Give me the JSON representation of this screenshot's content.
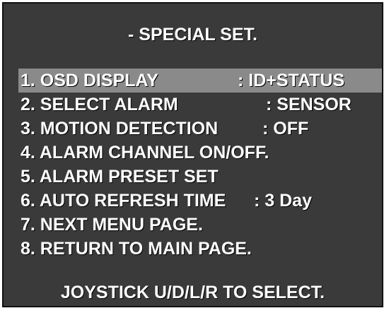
{
  "title": "- SPECIAL SET.",
  "menu": [
    {
      "label": "1. OSD DISPLAY",
      "value": ": ID+STATUS",
      "selected": true
    },
    {
      "label": "2. SELECT ALARM",
      "value": ": SENSOR",
      "selected": false
    },
    {
      "label": "3. MOTION DETECTION",
      "value": ": OFF",
      "selected": false
    },
    {
      "label": "4. ALARM CHANNEL ON/OFF.",
      "value": "",
      "selected": false
    },
    {
      "label": "5. ALARM PRESET SET",
      "value": "",
      "selected": false
    },
    {
      "label": "6. AUTO REFRESH TIME",
      "value": ": 3 Day",
      "selected": false
    },
    {
      "label": "7. NEXT MENU PAGE.",
      "value": "",
      "selected": false
    },
    {
      "label": "8. RETURN TO MAIN PAGE.",
      "value": "",
      "selected": false
    }
  ],
  "footer": "JOYSTICK U/D/L/R TO SELECT.",
  "colors": {
    "background": "#3a3a3a",
    "highlight": "#8a8a8a",
    "text": "#ffffff"
  }
}
